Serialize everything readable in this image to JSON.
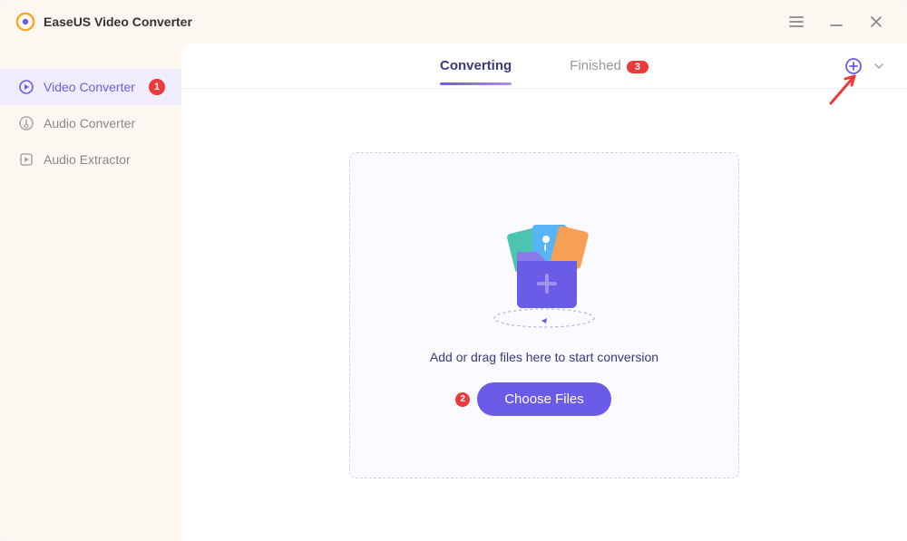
{
  "app": {
    "title": "EaseUS Video Converter"
  },
  "sidebar": {
    "items": [
      {
        "label": "Video Converter",
        "active": true,
        "badge": "1"
      },
      {
        "label": "Audio Converter",
        "active": false
      },
      {
        "label": "Audio Extractor",
        "active": false
      }
    ]
  },
  "tabs": {
    "converting": {
      "label": "Converting",
      "active": true
    },
    "finished": {
      "label": "Finished",
      "badge": "3",
      "active": false
    }
  },
  "dropzone": {
    "text": "Add or drag files here to start conversion",
    "button": "Choose Files",
    "annot": "2"
  },
  "colors": {
    "accent": "#6b5ce7",
    "badge": "#ec3a3a"
  }
}
